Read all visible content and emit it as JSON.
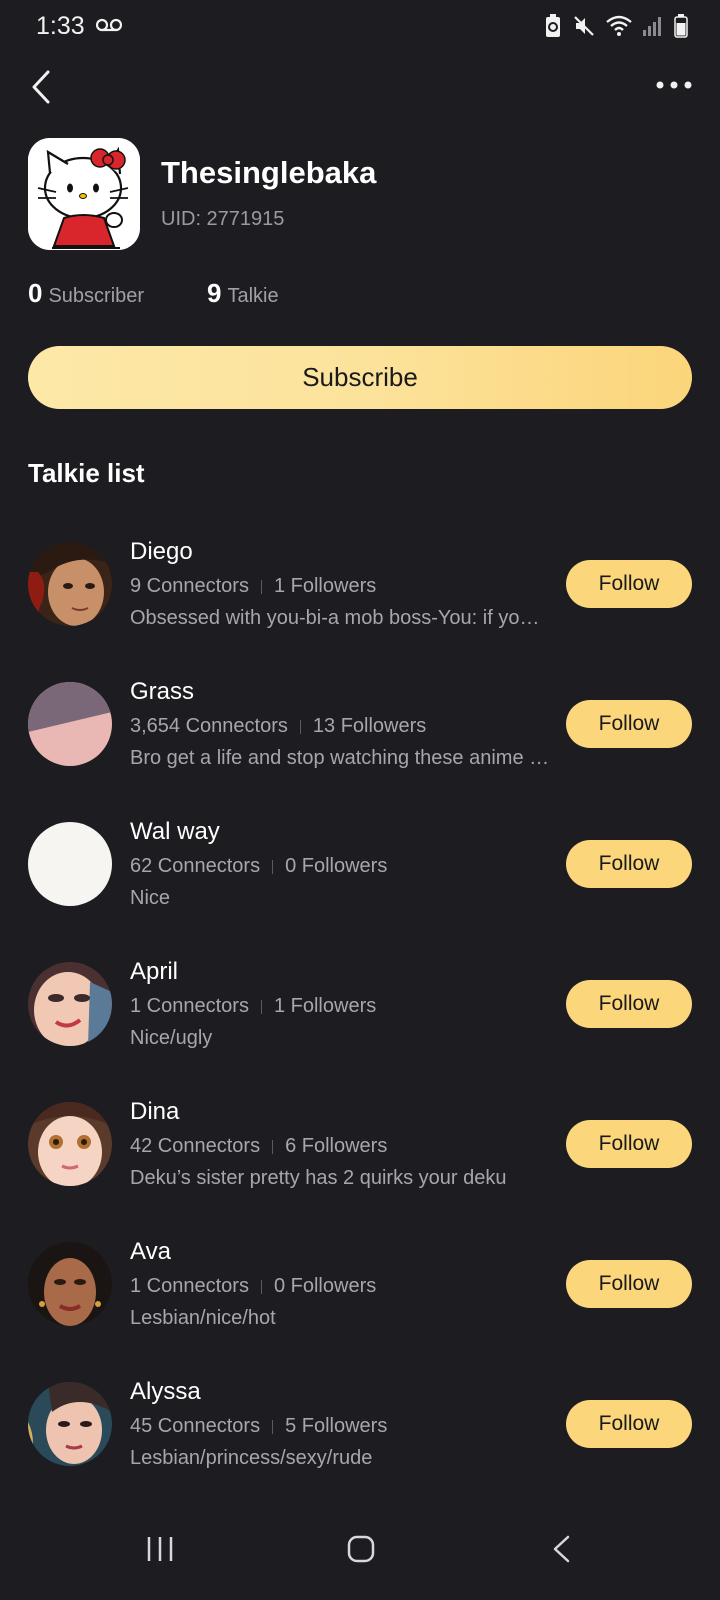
{
  "status_bar": {
    "time": "1:33",
    "icons": [
      "voicemail-icon",
      "battery-saver-icon",
      "mute-icon",
      "wifi-icon",
      "signal-icon",
      "battery-icon"
    ]
  },
  "profile": {
    "name": "Thesinglebaka",
    "uid": "UID: 2771915",
    "subscriber_count": "0",
    "subscriber_label": "Subscriber",
    "talkie_count": "9",
    "talkie_label": "Talkie"
  },
  "subscribe_label": "Subscribe",
  "section_title": "Talkie list",
  "talkies": [
    {
      "name": "Diego",
      "connectors": "9 Connectors",
      "followers": "1 Followers",
      "desc": "Obsessed with you-bi-a mob boss-You: if yo…",
      "follow": "Follow"
    },
    {
      "name": "Grass",
      "connectors": "3,654 Connectors",
      "followers": "13 Followers",
      "desc": "Bro get a life and stop watching these anime …",
      "follow": "Follow"
    },
    {
      "name": "Wal way",
      "connectors": "62 Connectors",
      "followers": "0 Followers",
      "desc": "Nice",
      "follow": "Follow"
    },
    {
      "name": "April",
      "connectors": "1 Connectors",
      "followers": "1 Followers",
      "desc": "Nice/ugly",
      "follow": "Follow"
    },
    {
      "name": "Dina",
      "connectors": "42 Connectors",
      "followers": "6 Followers",
      "desc": "Deku’s sister pretty has 2 quirks your deku",
      "follow": "Follow"
    },
    {
      "name": "Ava",
      "connectors": "1 Connectors",
      "followers": "0 Followers",
      "desc": "Lesbian/nice/hot",
      "follow": "Follow"
    },
    {
      "name": "Alyssa",
      "connectors": "45 Connectors",
      "followers": "5 Followers",
      "desc": "Lesbian/princess/sexy/rude",
      "follow": "Follow"
    }
  ],
  "colors": {
    "background": "#1c1c21",
    "accent": "#fcd67a",
    "muted_text": "#a6a6ae"
  }
}
